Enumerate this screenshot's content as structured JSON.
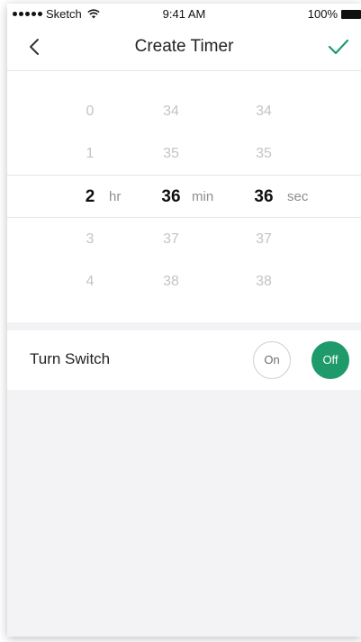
{
  "status_bar": {
    "carrier": "Sketch",
    "time": "9:41 AM",
    "battery": "100%"
  },
  "nav": {
    "title": "Create Timer",
    "back_icon": "chevron-left-icon",
    "confirm_icon": "checkmark-icon"
  },
  "picker": {
    "units": {
      "hours": "hr",
      "minutes": "min",
      "seconds": "sec"
    },
    "rows": [
      {
        "hours": "0",
        "minutes": "34",
        "seconds": "34"
      },
      {
        "hours": "1",
        "minutes": "35",
        "seconds": "35"
      },
      {
        "hours": "2",
        "minutes": "36",
        "seconds": "36"
      },
      {
        "hours": "3",
        "minutes": "37",
        "seconds": "37"
      },
      {
        "hours": "4",
        "minutes": "38",
        "seconds": "38"
      }
    ],
    "selected_index": 2
  },
  "switch": {
    "label": "Turn Switch",
    "on_label": "On",
    "off_label": "Off",
    "selected": "Off"
  },
  "colors": {
    "accent": "#1f9a6a",
    "muted_text": "#c4c4c4",
    "unit_text": "#8e8e8e",
    "background": "#f3f3f5"
  }
}
